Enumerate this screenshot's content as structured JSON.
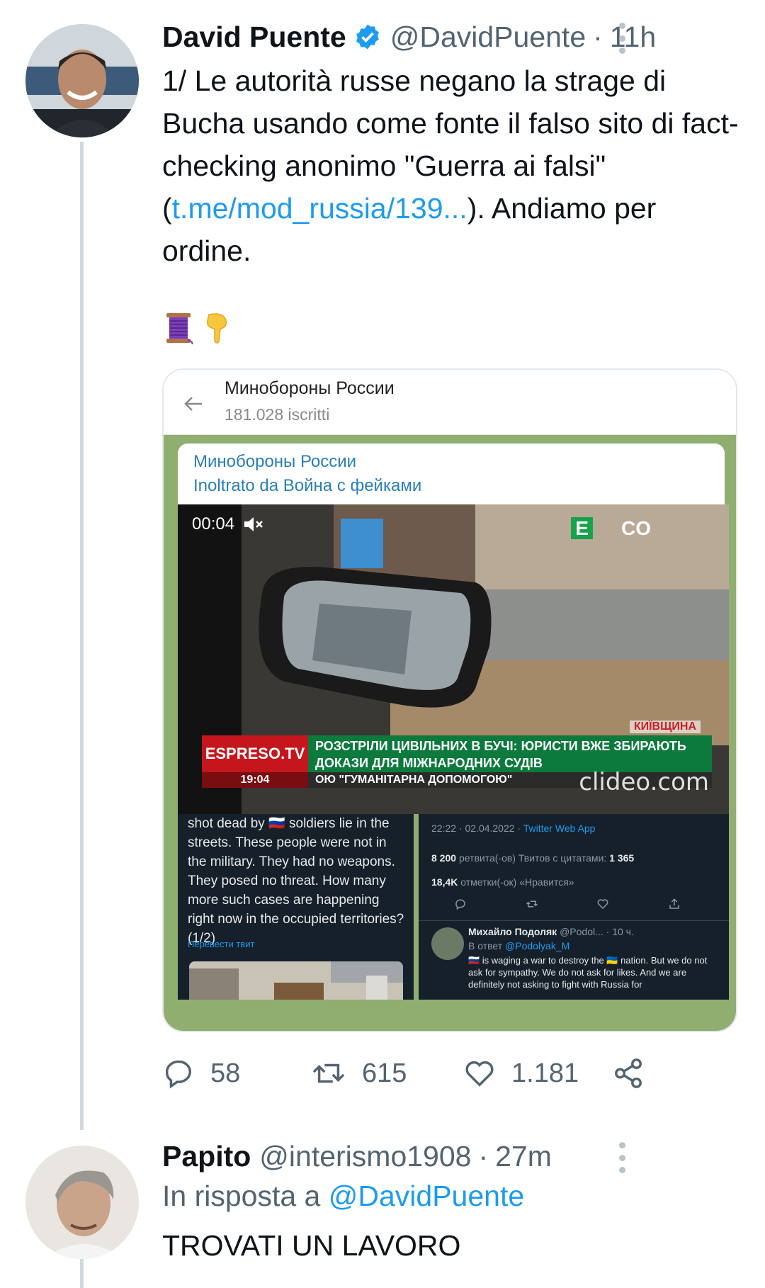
{
  "tweet": {
    "author_name": "David Puente",
    "author_handle": "@DavidPuente",
    "separator": "·",
    "time": "11h",
    "text_before_link": "1/ Le autorità russe negano la strage di Bucha usando come fonte il falso sito di fact-checking anonimo \"Guerra ai falsi\" (",
    "link_text": "t.me/mod_russia/139...",
    "text_after_link": "). Andiamo per ordine.",
    "emojis": [
      "thread-spool-emoji",
      "pointing-down-emoji"
    ],
    "stats": {
      "replies": "58",
      "retweets": "615",
      "likes": "1.181"
    }
  },
  "embedded_screenshot": {
    "channel_name": "Минобороны России",
    "subscribers": "181.028 iscritti",
    "forward_channel": "Минобороны России",
    "forwarded_from": "Inoltrato da Война с фейками",
    "video": {
      "timestamp": "00:04",
      "tv_logo_letter": "E",
      "tv_logo_suffix": "CO",
      "region": "КИЇВЩИНА",
      "network": "ESPRESO.TV",
      "headline": "РОЗСТРІЛИ ЦИВІЛЬНИХ В БУЧІ: ЮРИСТИ ВЖЕ ЗБИРАЮТЬ ДОКАЗИ ДЛЯ МІЖНАРОДНИХ СУДІВ",
      "clock": "19:04",
      "ticker": "ОЮ \"ГУМАНІТАРНА ДОПОМОГОЮ\"",
      "watermark": "clideo.com"
    },
    "left_panel": {
      "text": "shot dead by 🇷🇺 soldiers lie in the streets. These people were not in the military. They had no weapons. They posed no threat. How many more such cases are happening right now in the occupied territories? (1/2)",
      "translate_label": "Перевести твит"
    },
    "right_panel": {
      "meta": "22:22 · 02.04.2022 · ",
      "meta_app": "Twitter Web App",
      "retweets_count": "8 200",
      "retweets_label": "ретвита(-ов)",
      "quotes_label": "Твитов с цитатами:",
      "quotes_count": "1 365",
      "likes_count": "18,4K",
      "likes_label": "отметки(-ок) «Нравится»",
      "reply_author": "Михайло Подоляк",
      "reply_author_meta": "@Podol... · 10 ч.",
      "reply_to_label": "В ответ",
      "reply_to_handle": "@Podolyak_M",
      "reply_body": "🇷🇺 is waging a war to destroy the 🇺🇦 nation. But we do not ask for sympathy. We do not ask for likes. And we are definitely not asking to fight with Russia for"
    }
  },
  "reply": {
    "author_name": "Papito",
    "author_handle": "@interismo1908",
    "separator": "·",
    "time": "27m",
    "reply_to_prefix": "In risposta a",
    "reply_to_handle": "@DavidPuente",
    "text": "TROVATI UN LAVORO"
  },
  "colors": {
    "accent": "#1d9bf0",
    "secondary_text": "#536471",
    "telegram_background": "#8fae70",
    "espreso_red": "#c4161c",
    "espreso_green": "#0c7a3d"
  }
}
